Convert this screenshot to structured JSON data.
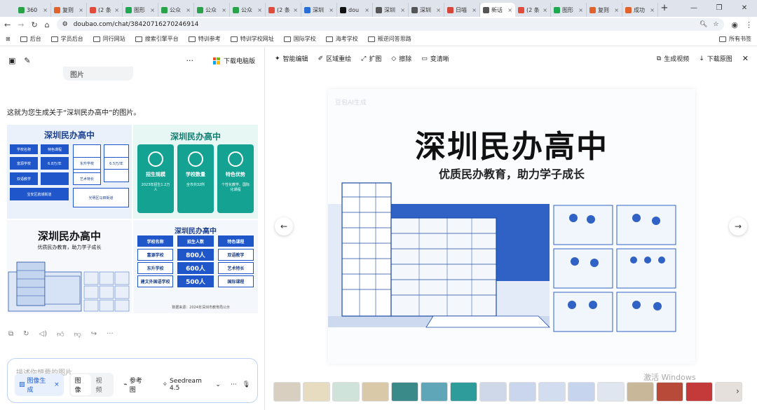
{
  "browser": {
    "tabs": [
      {
        "label": "360",
        "color": "#2aa24a"
      },
      {
        "label": "复则",
        "color": "#e0632b"
      },
      {
        "label": "(2 条",
        "color": "#e04b3b"
      },
      {
        "label": "图形",
        "color": "#1ea84f"
      },
      {
        "label": "公众",
        "color": "#2aa24a"
      },
      {
        "label": "公众",
        "color": "#2aa24a"
      },
      {
        "label": "公众",
        "color": "#2aa24a"
      },
      {
        "label": "(2 条",
        "color": "#e04b3b"
      },
      {
        "label": "深圳",
        "color": "#2b6fd6"
      },
      {
        "label": "dou",
        "color": "#111111"
      },
      {
        "label": "深圳",
        "color": "#555555"
      },
      {
        "label": "深圳",
        "color": "#555555"
      },
      {
        "label": "日喵",
        "color": "#d6453a"
      },
      {
        "label": "新话",
        "color": "#555555"
      },
      {
        "label": "(2 条",
        "color": "#e04b3b"
      },
      {
        "label": "图形",
        "color": "#1ea84f"
      },
      {
        "label": "复则",
        "color": "#e0632b"
      },
      {
        "label": "成功",
        "color": "#e0632b"
      }
    ],
    "url": "doubao.com/chat/38420716270246914",
    "bookmarks": [
      "后台",
      "学员后台",
      "同行网站",
      "搜索引擎平台",
      "特训参考",
      "特训学校网址",
      "国际学校",
      "海考学校",
      "叛逆问答思路"
    ],
    "other_bookmarks": "所有书签"
  },
  "chat": {
    "download_pc": "下载电脑版",
    "prev_bubble": "图片",
    "reply_text": "这就为您生成关于“深圳民办高中”的图片。",
    "input_placeholder": "描述你想要的图片",
    "image_gen_chip": "图像生成",
    "seg_image": "图像",
    "seg_video": "视频",
    "reference": "参考图",
    "model": "Seedream 4.5"
  },
  "panel1": {
    "title": "深圳民办高中",
    "cells": [
      "学校名称",
      "特色课程",
      "学费标准",
      "地址",
      "富源学校",
      "6.8万/年",
      "东升学校",
      "6.5万/年",
      "双语教学",
      "艺术特长",
      "宝安区航城街道",
      "光明区马田街道"
    ]
  },
  "panel2": {
    "title": "深圳民办高中",
    "cards": [
      {
        "head": "招生规模",
        "body": "2023年招生1.2万人"
      },
      {
        "head": "学校数量",
        "body": "全市共32所"
      },
      {
        "head": "特色优势",
        "body": "个性化教学、国际化课程"
      }
    ]
  },
  "panel3": {
    "title": "深圳民办高中",
    "subtitle": "优质民办教育，助力学子成长"
  },
  "panel4": {
    "title": "深圳民办高中",
    "headers": [
      "学校名称",
      "招生人数",
      "特色课程"
    ],
    "rows": [
      [
        "富源学校",
        "800人",
        "双语教学"
      ],
      [
        "东升学校",
        "600人",
        "艺术特长"
      ],
      [
        "建文外国语学校",
        "500人",
        "国际课程"
      ]
    ],
    "source": "数据来源：2024年深圳市教育局公示"
  },
  "viewer": {
    "tools": [
      "智能编辑",
      "区域重绘",
      "扩图",
      "擦除",
      "变清晰"
    ],
    "gen_video": "生成视频",
    "download": "下载原图",
    "image_title": "深圳民办高中",
    "image_subtitle": "优质民办教育，助力学子成长",
    "watermark": "豆包AI生成",
    "thumb_colors": [
      "#d8cfc0",
      "#e8dcc0",
      "#cfe3da",
      "#d9c9a8",
      "#3a8a8a",
      "#5fa7b8",
      "#2f9c9c",
      "#cfd8e8",
      "#c9d6ee",
      "#d2ddf0",
      "#c6d4ee",
      "#e0e6f0",
      "#c9b79a",
      "#b84a3a",
      "#c43a3a",
      "#e6e0dc"
    ]
  },
  "windows_mark": "激活 Windows"
}
